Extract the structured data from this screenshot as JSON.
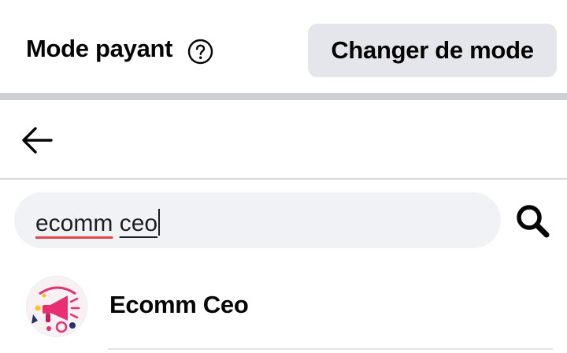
{
  "header": {
    "title": "Mode payant",
    "change_mode_label": "Changer de mode"
  },
  "search": {
    "query_word1": "ecomm",
    "query_word2": "ceo"
  },
  "results": [
    {
      "name": "Ecomm Ceo"
    }
  ],
  "icons": {
    "help": "question-circle-icon",
    "back": "arrow-left-icon",
    "search": "magnifier-icon"
  },
  "colors": {
    "button_bg": "#e4e6eb",
    "search_bg": "#f0f2f5",
    "spellcheck_underline": "#e4474a",
    "divider": "#cdd0d4"
  }
}
